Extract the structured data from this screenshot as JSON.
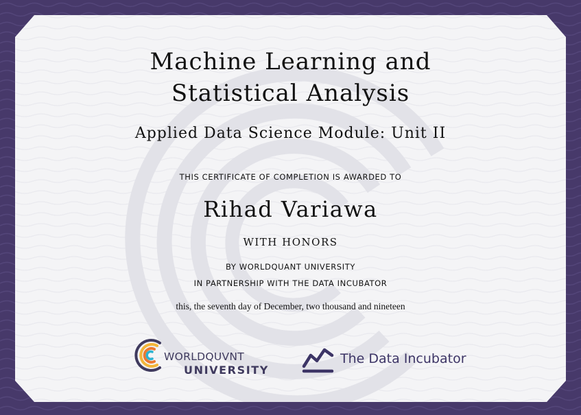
{
  "colors": {
    "border": "#47396a",
    "paper": "#f4f4f6",
    "watermark": "#e4e4ea",
    "text": "#111111",
    "logo_purple": "#3f3a5e",
    "logo_yellow": "#f3b63a",
    "logo_orange": "#ec7a32",
    "logo_cyan": "#2bb3d1"
  },
  "certificate": {
    "title_line1": "Machine Learning and",
    "title_line2": "Statistical Analysis",
    "subtitle": "Applied Data Science Module: Unit II",
    "awarded_to": "THIS CERTIFICATE OF COMPLETION IS AWARDED TO",
    "recipient": "Rihad Variawa",
    "honors": "WITH HONORS",
    "issuer": "BY WORLDQUANT UNIVERSITY",
    "partnership": "IN PARTNERSHIP WITH THE DATA INCUBATOR",
    "date": "this, the seventh day of December, two thousand and nineteen"
  },
  "logos": {
    "worldquant_line1": "WORLDQUVNT",
    "worldquant_line2": "UNIVERSITY",
    "worldquant_icon": "worldquant-c-icon",
    "data_incubator": "The Data Incubator",
    "data_incubator_icon": "zigzag-chart-icon"
  }
}
